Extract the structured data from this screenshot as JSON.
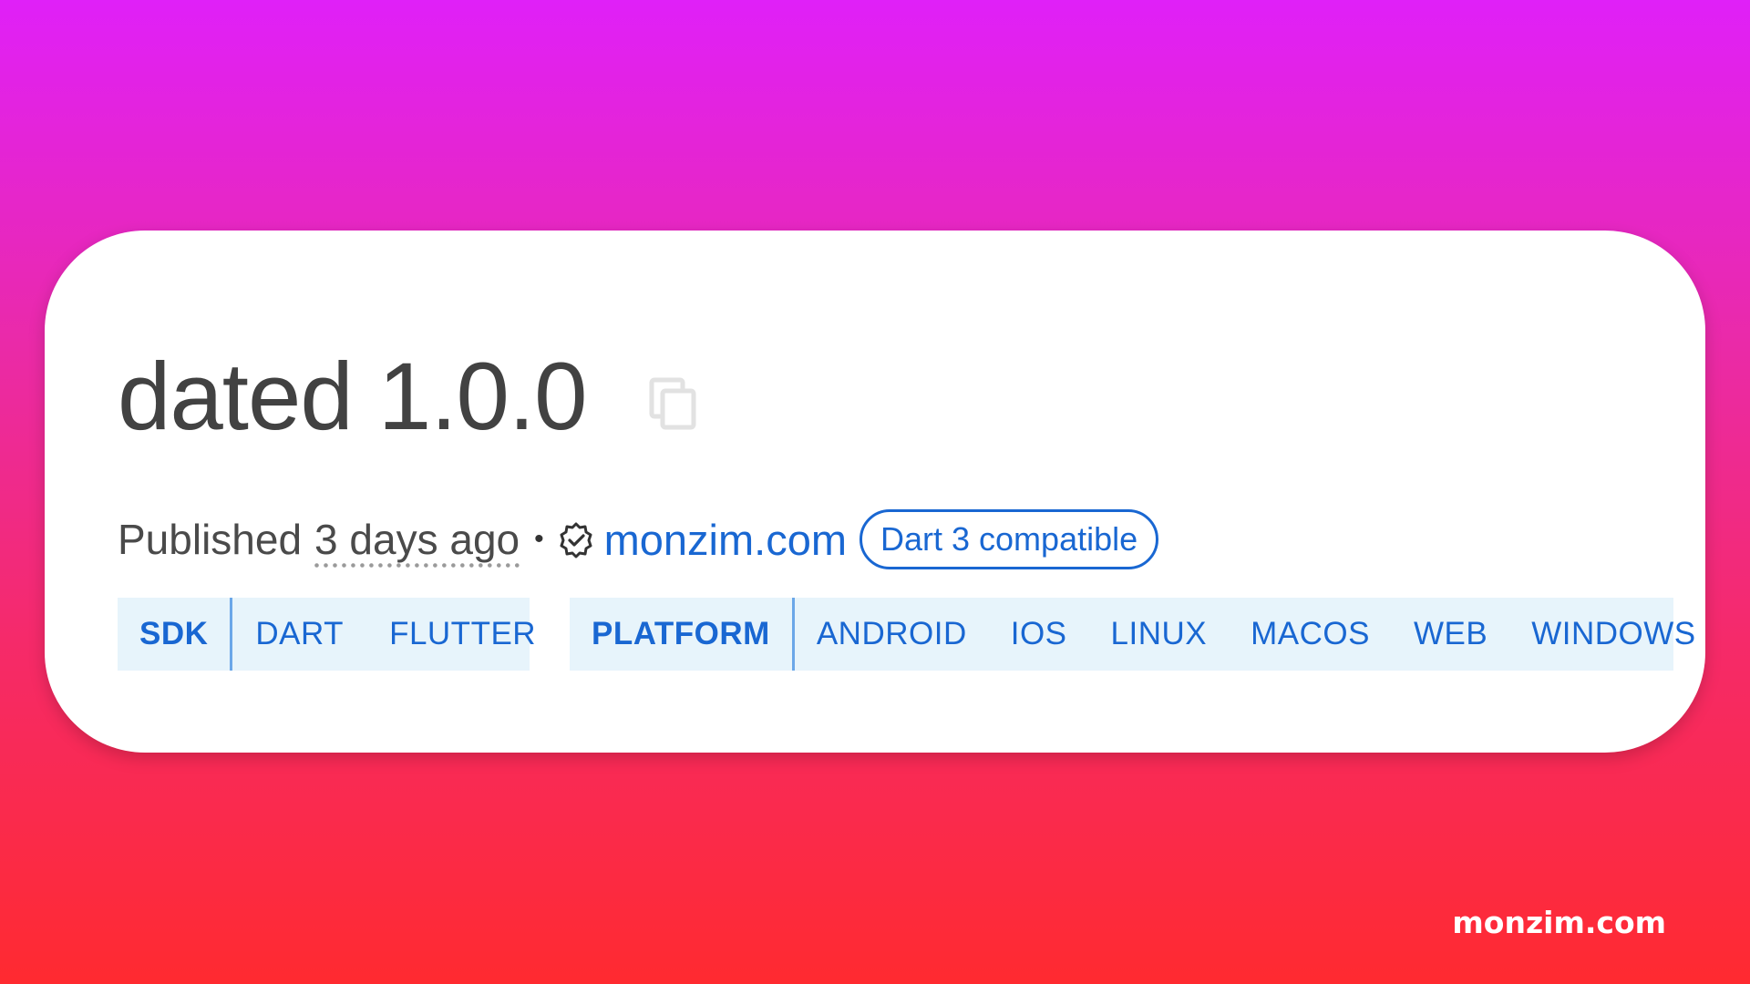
{
  "package": {
    "title": "dated 1.0.0",
    "copy_icon": "copy-icon"
  },
  "meta": {
    "published_label": "Published",
    "published_ago": "3 days ago",
    "separator": "•",
    "verified_icon": "verified-publisher-icon",
    "publisher": "monzim.com",
    "badge": "Dart 3 compatible"
  },
  "tags": {
    "sdk": {
      "label": "SDK",
      "items": [
        "DART",
        "FLUTTER"
      ]
    },
    "platform": {
      "label": "PLATFORM",
      "items": [
        "ANDROID",
        "IOS",
        "LINUX",
        "MACOS",
        "WEB",
        "WINDOWS"
      ]
    }
  },
  "watermark": "monzim.com",
  "colors": {
    "accent": "#1967d2",
    "tag_background": "#e7f4fb",
    "title_text": "#424242"
  }
}
